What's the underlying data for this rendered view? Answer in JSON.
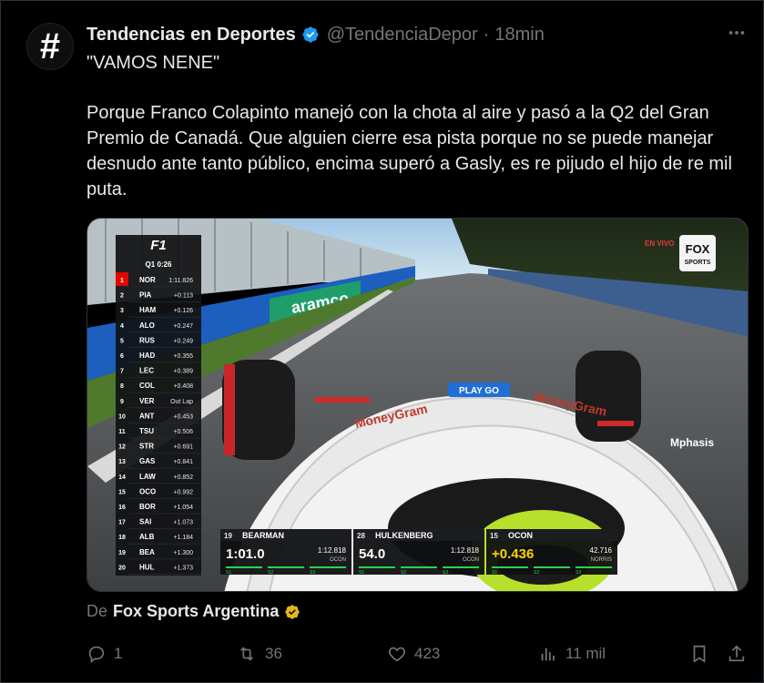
{
  "account": {
    "name": "Tendencias en Deportes",
    "handle": "@TendenciaDepor",
    "separator": "·",
    "time": "18min",
    "avatar_glyph": "#",
    "verified_color": "#1d9bf0"
  },
  "tweet": {
    "title": "\"VAMOS NENE\"",
    "body": "Porque Franco Colapinto manejó con la chota al aire y pasó a la Q2 del Gran Premio de Canadá. Que alguien cierre esa pista porque no se puede manejar desnudo ante tanto público, encima superó a Gasly, es re pijudo el hijo de re mil puta."
  },
  "media": {
    "broadcast": {
      "live_label": "EN VIVO",
      "network_line1": "FOX",
      "network_line2": "SPORTS",
      "billboard_text": "aramco"
    },
    "timing_tower": {
      "logo": "F1",
      "session": "Q1 0:26",
      "rows": [
        {
          "pos": "1",
          "code": "NOR",
          "gap": "1:11.826"
        },
        {
          "pos": "2",
          "code": "PIA",
          "gap": "+0.113"
        },
        {
          "pos": "3",
          "code": "HAM",
          "gap": "+0.126"
        },
        {
          "pos": "4",
          "code": "ALO",
          "gap": "+0.247"
        },
        {
          "pos": "5",
          "code": "RUS",
          "gap": "+0.249"
        },
        {
          "pos": "6",
          "code": "HAD",
          "gap": "+0.355"
        },
        {
          "pos": "7",
          "code": "LEC",
          "gap": "+0.389"
        },
        {
          "pos": "8",
          "code": "COL",
          "gap": "+0.408"
        },
        {
          "pos": "9",
          "code": "VER",
          "gap": "Out Lap"
        },
        {
          "pos": "10",
          "code": "ANT",
          "gap": "+0.453"
        },
        {
          "pos": "11",
          "code": "TSU",
          "gap": "+0.506"
        },
        {
          "pos": "12",
          "code": "STR",
          "gap": "+0.691"
        },
        {
          "pos": "13",
          "code": "GAS",
          "gap": "+0.841"
        },
        {
          "pos": "14",
          "code": "LAW",
          "gap": "+0.852"
        },
        {
          "pos": "15",
          "code": "OCO",
          "gap": "+0.992"
        },
        {
          "pos": "16",
          "code": "BOR",
          "gap": "+1.054"
        },
        {
          "pos": "17",
          "code": "SAI",
          "gap": "+1.073"
        },
        {
          "pos": "18",
          "code": "ALB",
          "gap": "+1.184"
        },
        {
          "pos": "19",
          "code": "BEA",
          "gap": "+1.300"
        },
        {
          "pos": "20",
          "code": "HUL",
          "gap": "+1.373"
        }
      ]
    },
    "onboard_boxes": [
      {
        "num": "19",
        "name": "BEARMAN",
        "time": "1:01.0",
        "ref_time": "1:12.818",
        "ref_driver": "OCON",
        "sectors": [
          "S1",
          "S2",
          "S3"
        ],
        "time_color": "#ffffff"
      },
      {
        "num": "28",
        "name": "HULKENBERG",
        "time": "54.0",
        "ref_time": "1:12.818",
        "ref_driver": "OCON",
        "sectors": [
          "S1",
          "S2",
          "S3"
        ],
        "time_color": "#ffffff"
      },
      {
        "num": "15",
        "name": "OCON",
        "time": "+0.436",
        "ref_time": "42.716",
        "ref_driver": "NORRIS",
        "sectors": [
          "S1",
          "S2",
          "S3"
        ],
        "time_color": "#ffd400"
      }
    ],
    "car_sponsors": [
      "MoneyGram",
      "MoneyGram",
      "Mphasis",
      "PLAY GO"
    ]
  },
  "source": {
    "prefix": "De",
    "name": "Fox Sports Argentina",
    "badge_color": "#e2b719"
  },
  "actions": {
    "replies": "1",
    "reposts": "36",
    "likes": "423",
    "views": "11 mil"
  }
}
